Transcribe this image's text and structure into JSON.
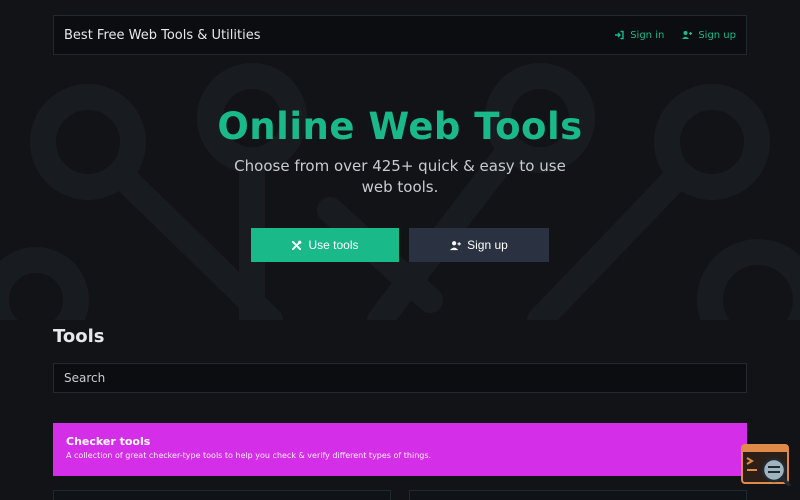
{
  "navbar": {
    "brand": "Best Free Web Tools & Utilities",
    "sign_in": "Sign in",
    "sign_up": "Sign up"
  },
  "hero": {
    "title": "Online Web Tools",
    "subtitle": "Choose from over 425+ quick & easy to use web tools.",
    "use_tools": "Use tools",
    "sign_up": "Sign up"
  },
  "tools": {
    "heading": "Tools",
    "search_placeholder": "Search"
  },
  "categories": [
    {
      "title": "Checker tools",
      "description": "A collection of great checker-type tools to help you check & verify different types of things.",
      "color": "#d42ee8"
    }
  ],
  "theme": {
    "accent": "#19b98a",
    "background": "#111317",
    "secondary_button": "#2a3140"
  },
  "icons": {
    "sign_in": "sign-in-icon",
    "sign_up": "user-plus-icon",
    "use_tools": "tools-icon",
    "widget": "terminal-search-icon"
  }
}
